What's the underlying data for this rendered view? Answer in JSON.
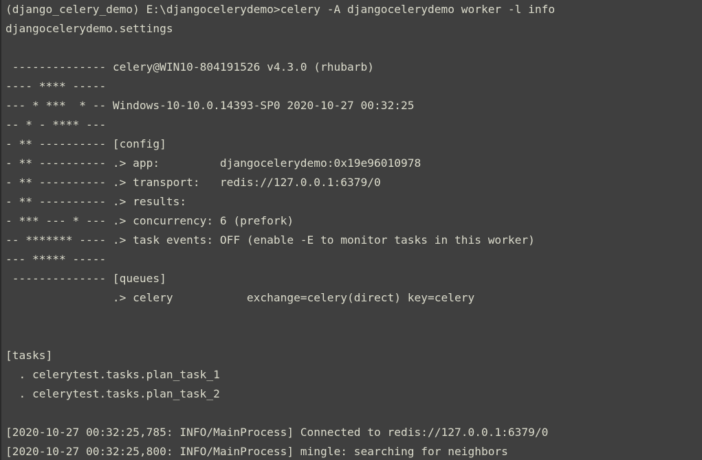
{
  "terminal": {
    "colors": {
      "background": "#3f3f3f",
      "foreground": "#dcdccc"
    },
    "lines": [
      "(django_celery_demo) E:\\djangocelerydemo>celery -A djangocelerydemo worker -l info",
      "djangocelerydemo.settings",
      "",
      " -------------- celery@WIN10-804191526 v4.3.0 (rhubarb)",
      "---- **** -----",
      "--- * ***  * -- Windows-10-10.0.14393-SP0 2020-10-27 00:32:25",
      "-- * - **** ---",
      "- ** ---------- [config]",
      "- ** ---------- .> app:         djangocelerydemo:0x19e96010978",
      "- ** ---------- .> transport:   redis://127.0.0.1:6379/0",
      "- ** ---------- .> results:",
      "- *** --- * --- .> concurrency: 6 (prefork)",
      "-- ******* ---- .> task events: OFF (enable -E to monitor tasks in this worker)",
      "--- ***** -----",
      " -------------- [queues]",
      "                .> celery           exchange=celery(direct) key=celery",
      "",
      "",
      "[tasks]",
      "  . celerytest.tasks.plan_task_1",
      "  . celerytest.tasks.plan_task_2",
      "",
      "[2020-10-27 00:32:25,785: INFO/MainProcess] Connected to redis://127.0.0.1:6379/0",
      "[2020-10-27 00:32:25,800: INFO/MainProcess] mingle: searching for neighbors"
    ]
  }
}
